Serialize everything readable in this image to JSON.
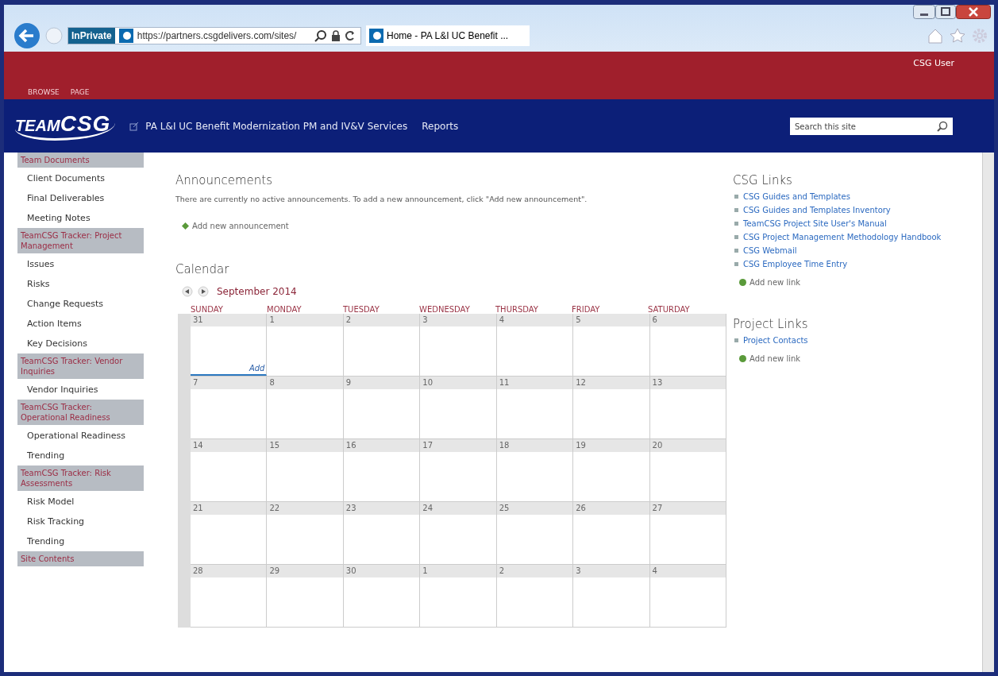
{
  "browser": {
    "inprivate": "InPrivate",
    "address": "https://partners.csgdelivers.com/sites/",
    "tab_title": "Home - PA L&I UC Benefit ..."
  },
  "suite_bar": {
    "tabs": [
      "BROWSE",
      "PAGE"
    ],
    "user": "CSG User"
  },
  "header": {
    "logo": {
      "first": "TEAM",
      "second": "CSG"
    },
    "nav": [
      "PA L&I UC Benefit Modernization PM and IV&V Services",
      "Reports"
    ],
    "search": {
      "placeholder": "Search this site"
    }
  },
  "sidebar": [
    {
      "heading": "Team Documents",
      "items": [
        "Client Documents",
        "Final Deliverables",
        "Meeting Notes"
      ]
    },
    {
      "heading": "TeamCSG Tracker: Project Management",
      "items": [
        "Issues",
        "Risks",
        "Change Requests",
        "Action Items",
        "Key Decisions"
      ]
    },
    {
      "heading": "TeamCSG Tracker: Vendor Inquiries",
      "items": [
        "Vendor Inquiries"
      ]
    },
    {
      "heading": "TeamCSG Tracker: Operational Readiness",
      "items": [
        "Operational Readiness",
        "Trending"
      ]
    },
    {
      "heading": "TeamCSG Tracker: Risk Assessments",
      "items": [
        "Risk Model",
        "Risk Tracking",
        "Trending"
      ]
    },
    {
      "heading": "Site Contents"
    }
  ],
  "announcements": {
    "title": "Announcements",
    "message": "There are currently no active announcements. To add a new announcement, click \"Add new announcement\".",
    "add_link": "Add new announcement"
  },
  "calendar": {
    "title": "Calendar",
    "month": "September 2014",
    "weekdays": [
      "SUNDAY",
      "MONDAY",
      "TUESDAY",
      "WEDNESDAY",
      "THURSDAY",
      "FRIDAY",
      "SATURDAY"
    ],
    "weeks": [
      [
        {
          "day": "31",
          "add_label": "Add"
        },
        {
          "day": "1"
        },
        {
          "day": "2"
        },
        {
          "day": "3"
        },
        {
          "day": "4"
        },
        {
          "day": "5"
        },
        {
          "day": "6"
        }
      ],
      [
        {
          "day": "7"
        },
        {
          "day": "8"
        },
        {
          "day": "9"
        },
        {
          "day": "10"
        },
        {
          "day": "11"
        },
        {
          "day": "12"
        },
        {
          "day": "13"
        }
      ],
      [
        {
          "day": "14"
        },
        {
          "day": "15"
        },
        {
          "day": "16"
        },
        {
          "day": "17"
        },
        {
          "day": "18"
        },
        {
          "day": "19"
        },
        {
          "day": "20"
        }
      ],
      [
        {
          "day": "21"
        },
        {
          "day": "22"
        },
        {
          "day": "23"
        },
        {
          "day": "24"
        },
        {
          "day": "25"
        },
        {
          "day": "26"
        },
        {
          "day": "27"
        }
      ],
      [
        {
          "day": "28"
        },
        {
          "day": "29"
        },
        {
          "day": "30"
        },
        {
          "day": "1"
        },
        {
          "day": "2"
        },
        {
          "day": "3"
        },
        {
          "day": "4"
        }
      ]
    ]
  },
  "link_lists": [
    {
      "title": "CSG Links",
      "items": [
        "CSG Guides and Templates",
        "CSG Guides and Templates Inventory",
        "TeamCSG Project Site User's Manual",
        "CSG Project Management Methodology Handbook",
        "CSG Webmail",
        "CSG Employee Time Entry"
      ],
      "add_link": "Add new link"
    },
    {
      "title": "Project Links",
      "items": [
        "Project Contacts"
      ],
      "add_link": "Add new link"
    }
  ]
}
